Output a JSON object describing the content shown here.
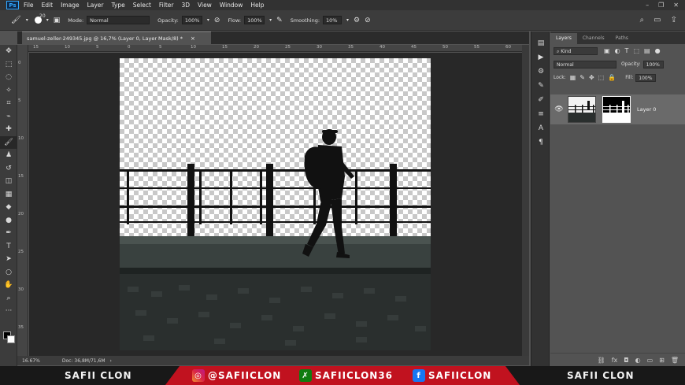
{
  "menu": {
    "logo": "Ps",
    "items": [
      "File",
      "Edit",
      "Image",
      "Layer",
      "Type",
      "Select",
      "Filter",
      "3D",
      "View",
      "Window",
      "Help"
    ]
  },
  "options": {
    "brush_size": "20",
    "mode_label": "Mode:",
    "mode_value": "Normal",
    "opacity_label": "Opacity:",
    "opacity_value": "100%",
    "flow_label": "Flow:",
    "flow_value": "100%",
    "smoothing_label": "Smoothing:",
    "smoothing_value": "10%"
  },
  "document": {
    "tab_title": "samuel-zeller-249345.jpg @ 16,7% (Layer 0, Layer Mask/8) *",
    "close": "×"
  },
  "ruler": {
    "h_labels": [
      "15",
      "10",
      "5",
      "0",
      "5",
      "10",
      "15",
      "20",
      "25",
      "30",
      "35",
      "40",
      "45",
      "50",
      "55",
      "60"
    ],
    "v_labels": [
      "0",
      "5",
      "10",
      "15",
      "20",
      "25",
      "30",
      "35"
    ]
  },
  "status": {
    "zoom": "16.67%",
    "doc_size": "Doc: 36,8M/71,6M"
  },
  "layers_panel": {
    "tabs": [
      "Layers",
      "Channels",
      "Paths"
    ],
    "kind_label": "Kind",
    "blend_mode": "Normal",
    "opacity_label": "Opacity:",
    "opacity_value": "100%",
    "lock_label": "Lock:",
    "fill_label": "Fill:",
    "fill_value": "100%",
    "layer_name": "Layer 0"
  },
  "banner": {
    "left_name": "SAFII CLON",
    "instagram": "@SAFIICLON",
    "xbox": "SAFIICLON36",
    "facebook": "SAFIICLON",
    "right_name": "SAFII CLON"
  },
  "colors": {
    "accent_red": "#c1121f",
    "ps_blue": "#31a8ff"
  }
}
